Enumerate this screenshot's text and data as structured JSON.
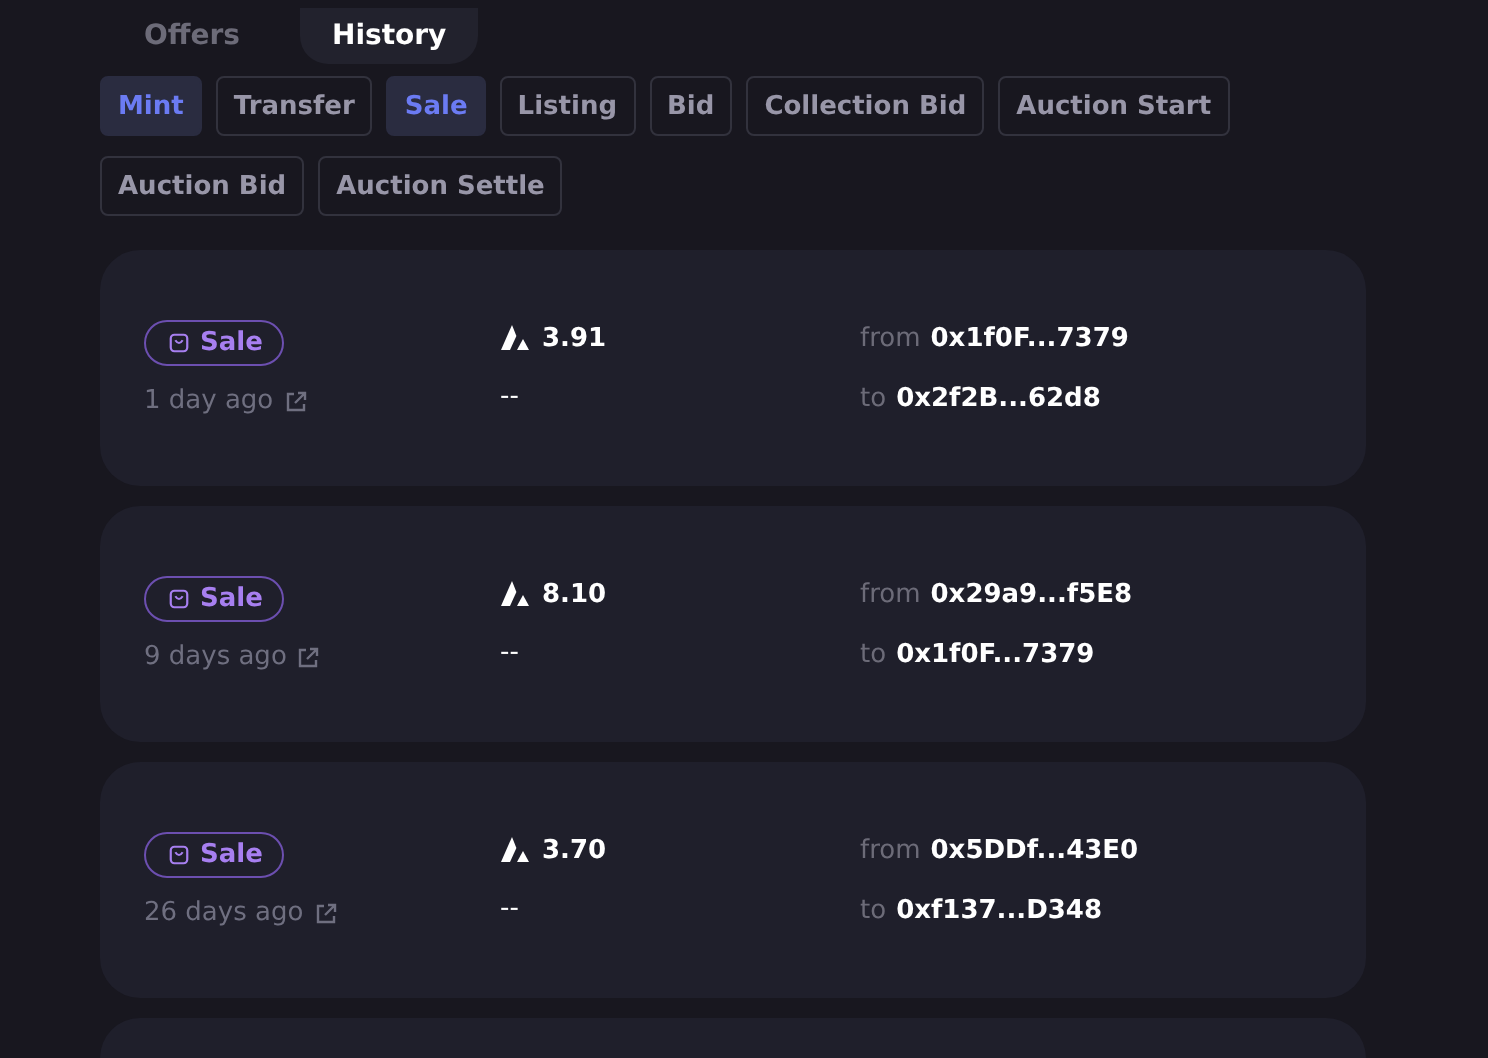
{
  "tabs": [
    {
      "label": "Offers",
      "selected": false
    },
    {
      "label": "History",
      "selected": true
    }
  ],
  "filters": [
    {
      "label": "Mint",
      "selected": true
    },
    {
      "label": "Transfer",
      "selected": false
    },
    {
      "label": "Sale",
      "selected": true
    },
    {
      "label": "Listing",
      "selected": false
    },
    {
      "label": "Bid",
      "selected": false
    },
    {
      "label": "Collection Bid",
      "selected": false
    },
    {
      "label": "Auction Start",
      "selected": false
    },
    {
      "label": "Auction Bid",
      "selected": false
    },
    {
      "label": "Auction Settle",
      "selected": false
    }
  ],
  "events": [
    {
      "type": "Sale",
      "time": "1 day ago",
      "price": "3.91",
      "usd": "--",
      "from_label": "from",
      "from": "0x1f0F...7379",
      "to_label": "to",
      "to": "0x2f2B...62d8"
    },
    {
      "type": "Sale",
      "time": "9 days ago",
      "price": "8.10",
      "usd": "--",
      "from_label": "from",
      "from": "0x29a9...f5E8",
      "to_label": "to",
      "to": "0x1f0F...7379"
    },
    {
      "type": "Sale",
      "time": "26 days ago",
      "price": "3.70",
      "usd": "--",
      "from_label": "from",
      "from": "0x5DDf...43E0",
      "to_label": "to",
      "to": "0xf137...D348"
    }
  ],
  "more_events_below": true
}
